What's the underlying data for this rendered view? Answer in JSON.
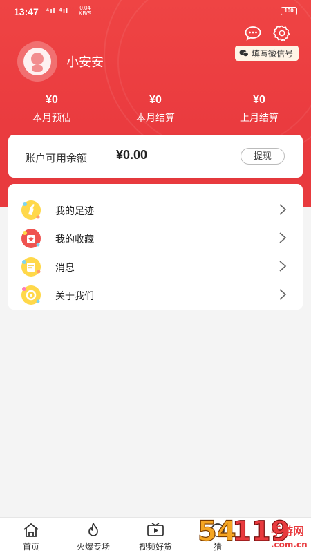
{
  "status_bar": {
    "time": "13:47",
    "signal": "⁴ıl ⁴ıl",
    "speed_top": "0.04",
    "speed_bottom": "KB/S",
    "battery": "100"
  },
  "header": {
    "username": "小安安",
    "wechat_tag": "填写微信号",
    "stats": [
      {
        "value": "¥0",
        "label": "本月预估"
      },
      {
        "value": "¥0",
        "label": "本月结算"
      },
      {
        "value": "¥0",
        "label": "上月结算"
      }
    ]
  },
  "balance": {
    "label": "账户可用余额",
    "amount": "¥0.00",
    "withdraw_label": "提现"
  },
  "menu": [
    {
      "label": "我的足迹",
      "icon": "footprint-icon"
    },
    {
      "label": "我的收藏",
      "icon": "favorites-icon"
    },
    {
      "label": "消息",
      "icon": "message-icon"
    },
    {
      "label": "关于我们",
      "icon": "about-icon"
    }
  ],
  "bottom_nav": [
    {
      "label": "首页",
      "icon": "home-icon"
    },
    {
      "label": "火爆专场",
      "icon": "flame-icon"
    },
    {
      "label": "视频好货",
      "icon": "video-icon"
    },
    {
      "label": "猜",
      "icon": "guess-icon"
    }
  ],
  "watermark": {
    "text": "54119手游网",
    "sub": ".com.cn"
  },
  "colors": {
    "primary": "#e83a3e",
    "background": "#f4f4f4",
    "card": "#ffffff",
    "tag_bg": "#fff4e6"
  }
}
